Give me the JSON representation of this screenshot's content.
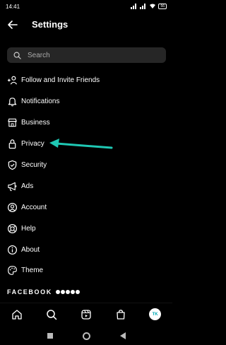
{
  "status": {
    "time": "14:41",
    "battery": "56"
  },
  "header": {
    "title": "Settings"
  },
  "search": {
    "placeholder": "Search"
  },
  "menu": {
    "items": [
      {
        "label": "Follow and Invite Friends",
        "icon": "add-person-icon"
      },
      {
        "label": "Notifications",
        "icon": "bell-icon"
      },
      {
        "label": "Business",
        "icon": "shop-icon"
      },
      {
        "label": "Privacy",
        "icon": "lock-icon"
      },
      {
        "label": "Security",
        "icon": "shield-icon"
      },
      {
        "label": "Ads",
        "icon": "megaphone-icon"
      },
      {
        "label": "Account",
        "icon": "person-circle-icon"
      },
      {
        "label": "Help",
        "icon": "lifebuoy-icon"
      },
      {
        "label": "About",
        "icon": "info-icon"
      },
      {
        "label": "Theme",
        "icon": "palette-icon"
      }
    ]
  },
  "footer": {
    "brand": "FACEBOOK"
  },
  "annotation": {
    "arrow_color": "#1fc8b4"
  },
  "colors": {
    "background": "#000000",
    "search_bg": "#262626",
    "text": "#ffffff"
  }
}
